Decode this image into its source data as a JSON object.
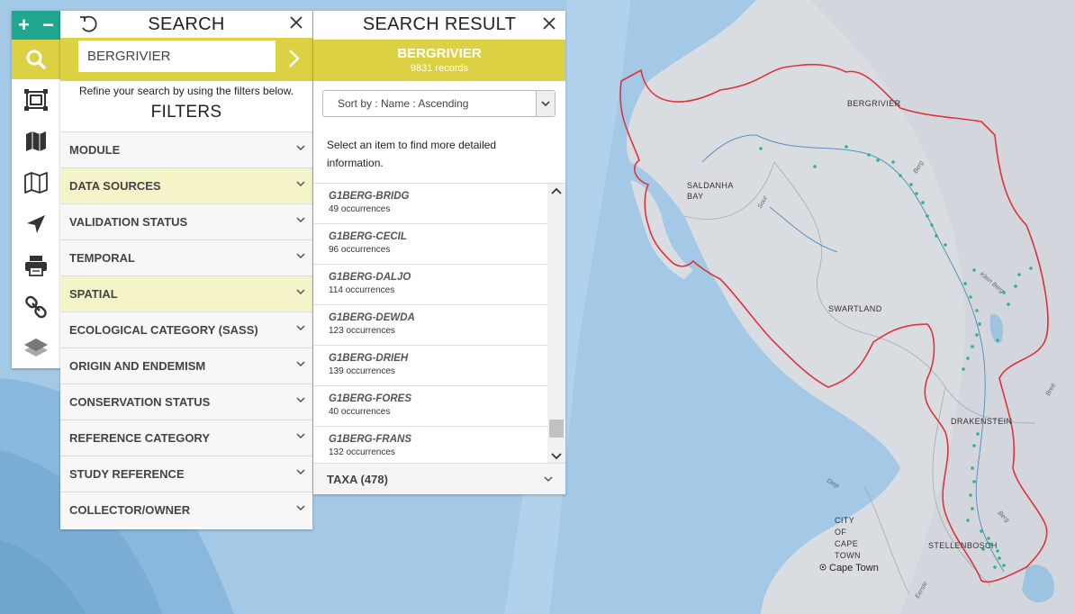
{
  "map": {
    "labels": [
      {
        "key": "bergrivier",
        "text": "BERGRIVIER"
      },
      {
        "key": "saldanha_1",
        "text": "SALDANHA"
      },
      {
        "key": "saldanha_2",
        "text": "BAY"
      },
      {
        "key": "swartland",
        "text": "SWARTLAND"
      },
      {
        "key": "drakenstein",
        "text": "DRAKENSTEIN"
      },
      {
        "key": "stellenbosch",
        "text": "STELLENBOSCH"
      },
      {
        "key": "city_1",
        "text": "CITY"
      },
      {
        "key": "city_2",
        "text": "OF"
      },
      {
        "key": "city_3",
        "text": "CAPE"
      },
      {
        "key": "city_4",
        "text": "TOWN"
      },
      {
        "key": "cape_town",
        "text": "Cape Town"
      }
    ],
    "river_labels": {
      "berg_1": "Berg",
      "berg_2": "Berg",
      "klein_berg": "Klein Berg",
      "sout": "Sout",
      "diep": "Diep",
      "breë": "Breë",
      "eerste": "Eerste"
    },
    "boundary_color": "#e0323c",
    "point_color": "#2ab58a"
  },
  "toolbar": {
    "zoom_in": "+",
    "zoom_out": "−",
    "icons": [
      "search-icon",
      "extent-icon",
      "basemap-icon",
      "map-outline-icon",
      "locate-icon",
      "print-icon",
      "link-icon",
      "layers-icon"
    ]
  },
  "search_panel": {
    "title": "SEARCH",
    "query": "BERGRIVIER",
    "hint": "Refine your search by using the filters below.",
    "filters_title": "FILTERS",
    "filters": [
      {
        "label": "MODULE",
        "highlighted": false
      },
      {
        "label": "DATA SOURCES",
        "highlighted": true
      },
      {
        "label": "VALIDATION STATUS",
        "highlighted": false
      },
      {
        "label": "TEMPORAL",
        "highlighted": false
      },
      {
        "label": "SPATIAL",
        "highlighted": true
      },
      {
        "label": "ECOLOGICAL CATEGORY (SASS)",
        "highlighted": false
      },
      {
        "label": "ORIGIN AND ENDEMISM",
        "highlighted": false
      },
      {
        "label": "CONSERVATION STATUS",
        "highlighted": false
      },
      {
        "label": "REFERENCE CATEGORY",
        "highlighted": false
      },
      {
        "label": "STUDY REFERENCE",
        "highlighted": false
      },
      {
        "label": "COLLECTOR/OWNER",
        "highlighted": false
      }
    ],
    "accent": "#dcd043"
  },
  "result_panel": {
    "title": "SEARCH RESULT",
    "name": "BERGRIVIER",
    "records": "9831 records",
    "sort": "Sort by : Name : Ascending",
    "hint": "Select an item to find more detailed information.",
    "items": [
      {
        "code": "G1BERG-BRIDG",
        "occ": "49 occurrences"
      },
      {
        "code": "G1BERG-CECIL",
        "occ": "96 occurrences"
      },
      {
        "code": "G1BERG-DALJO",
        "occ": "114 occurrences"
      },
      {
        "code": "G1BERG-DEWDA",
        "occ": "123 occurrences"
      },
      {
        "code": "G1BERG-DRIEH",
        "occ": "139 occurrences"
      },
      {
        "code": "G1BERG-FORES",
        "occ": "40 occurrences"
      },
      {
        "code": "G1BERG-FRANS",
        "occ": "132 occurrences"
      }
    ],
    "taxa": "TAXA (478)"
  }
}
